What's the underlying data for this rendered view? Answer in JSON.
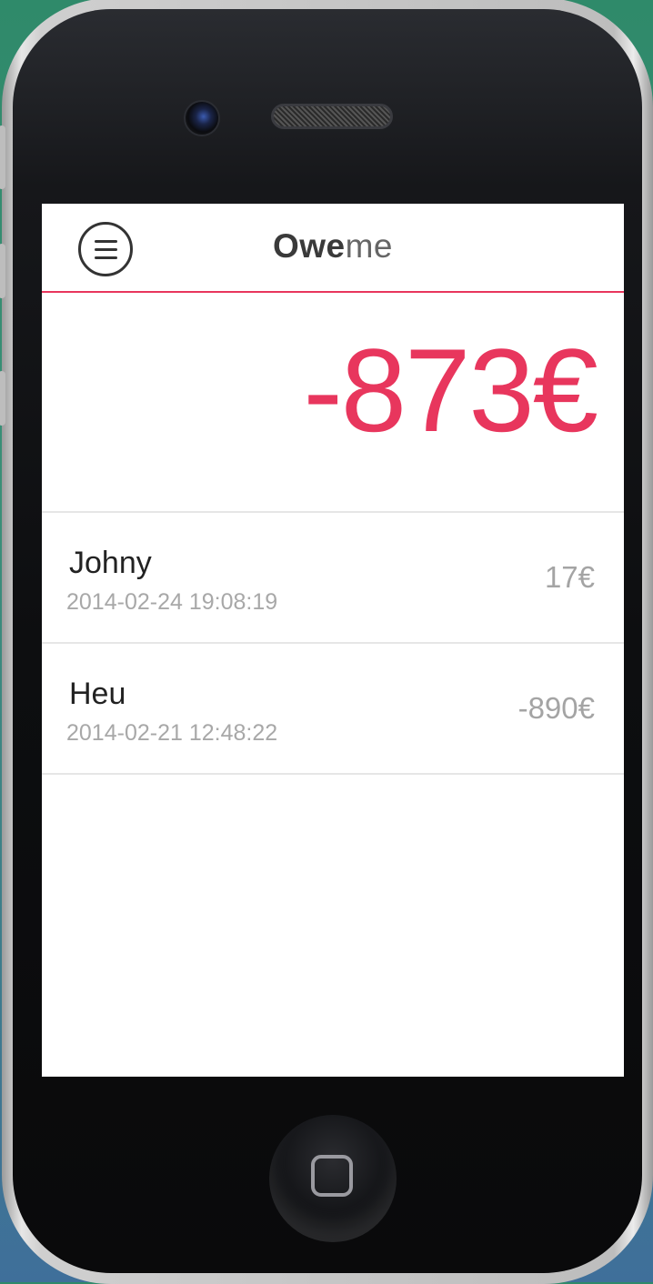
{
  "app": {
    "title_bold": "Owe",
    "title_light": "me",
    "menu_icon": "hamburger-icon",
    "accent_color": "#e8365d"
  },
  "balance": {
    "value": -873,
    "display": "-873€"
  },
  "transactions": [
    {
      "name": "Johny",
      "date": "2014-02-24 19:08:19",
      "amount": "17€"
    },
    {
      "name": "Heu",
      "date": "2014-02-21 12:48:22",
      "amount": "-890€"
    }
  ]
}
